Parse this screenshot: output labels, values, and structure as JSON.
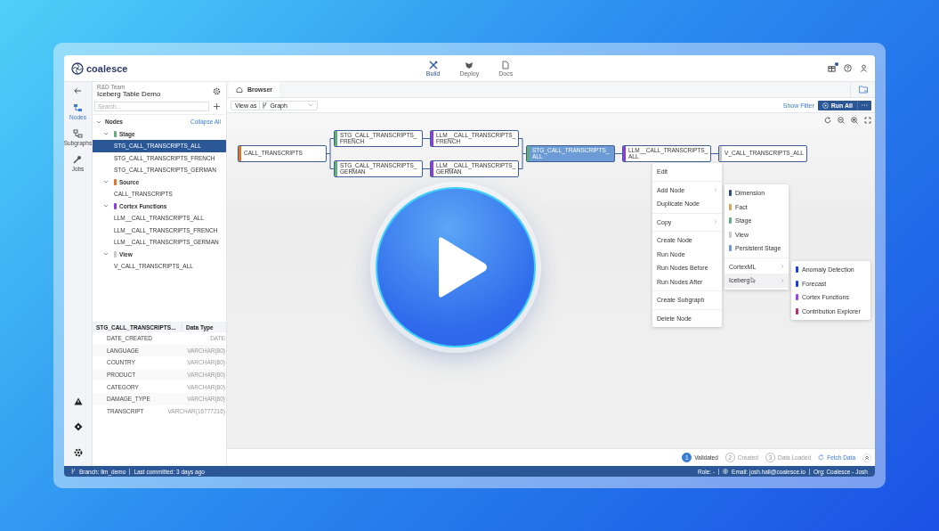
{
  "app": {
    "logo": "coalesce"
  },
  "nav_tabs": [
    {
      "label": "Build",
      "kind": "build",
      "selected": true
    },
    {
      "label": "Deploy",
      "kind": "deploy",
      "selected": false
    },
    {
      "label": "Docs",
      "kind": "docs",
      "selected": false
    }
  ],
  "header": {
    "gift_badge": true
  },
  "rail": [
    {
      "label": "Nodes",
      "kind": "nodes",
      "selected": true
    },
    {
      "label": "Subgraphs",
      "kind": "subgraphs",
      "selected": false
    },
    {
      "label": "Jobs",
      "kind": "jobs",
      "selected": false
    }
  ],
  "project": {
    "team": "R&D Team",
    "name": "Iceberg Table Demo"
  },
  "search": {
    "placeholder": "Search..."
  },
  "tree": {
    "label": "Nodes",
    "action": "Collapse All",
    "expanded": true,
    "children": [
      {
        "label": "Stage",
        "color": "#5fae7c",
        "expanded": true,
        "children": [
          {
            "label": "STG_CALL_TRANSCRIPTS_ALL",
            "selected": true
          },
          {
            "label": "STG_CALL_TRANSCRIPTS_FRENCH",
            "selected": false
          },
          {
            "label": "STG_CALL_TRANSCRIPTS_GERMAN",
            "selected": false
          }
        ]
      },
      {
        "label": "Source",
        "color": "#d9752c",
        "expanded": true,
        "children": [
          {
            "label": "CALL_TRANSCRIPTS",
            "selected": false
          }
        ]
      },
      {
        "label": "Cortex Functions",
        "color": "#8a3ee0",
        "expanded": true,
        "children": [
          {
            "label": "LLM__CALL_TRANSCRIPTS_ALL",
            "selected": false
          },
          {
            "label": "LLM__CALL_TRANSCRIPTS_FRENCH",
            "selected": false
          },
          {
            "label": "LLM__CALL_TRANSCRIPTS_GERMAN",
            "selected": false
          }
        ]
      },
      {
        "label": "View",
        "color": "#c8c8c8",
        "expanded": true,
        "children": [
          {
            "label": "V_CALL_TRANSCRIPTS_ALL",
            "selected": false
          }
        ]
      }
    ]
  },
  "columns_table": {
    "columns": [
      "STG_CALL_TRANSCRIPTS...",
      "Data Type"
    ],
    "rows": [
      {
        "name": "DATE_CREATED",
        "type": "DATE"
      },
      {
        "name": "LANGUAGE",
        "type": "VARCHAR(80)"
      },
      {
        "name": "COUNTRY",
        "type": "VARCHAR(80)"
      },
      {
        "name": "PRODUCT",
        "type": "VARCHAR(80)"
      },
      {
        "name": "CATEGORY",
        "type": "VARCHAR(80)"
      },
      {
        "name": "DAMAGE_TYPE",
        "type": "VARCHAR(80)"
      },
      {
        "name": "TRANSCRIPT",
        "type": "VARCHAR(16777216)"
      }
    ]
  },
  "browser_tab": {
    "label": "Browser"
  },
  "toolbar": {
    "view_as": "View as",
    "view": "Graph",
    "show_filter": "Show Filter",
    "run_all": "Run All"
  },
  "graph": {
    "nodes": [
      {
        "label": "CALL_TRANSCRIPTS",
        "color": "#d9752c",
        "selected": false
      },
      {
        "label": "STG_CALL_TRANSCRIPTS_FRENCH",
        "color": "#5fae7c",
        "selected": false
      },
      {
        "label": "STG_CALL_TRANSCRIPTS_GERMAN",
        "color": "#5fae7c",
        "selected": false
      },
      {
        "label": "LLM__CALL_TRANSCRIPTS_FRENCH",
        "color": "#8a3ee0",
        "selected": false
      },
      {
        "label": "LLM__CALL_TRANSCRIPTS_GERMAN",
        "color": "#8a3ee0",
        "selected": false
      },
      {
        "label": "STG_CALL_TRANSCRIPTS_ALL",
        "color": "#5fae7c",
        "selected": true
      },
      {
        "label": "LLM__CALL_TRANSCRIPTS_ALL",
        "color": "#8a3ee0",
        "selected": false
      },
      {
        "label": "V_CALL_TRANSCRIPTS_ALL",
        "color": "#c8c8c8",
        "selected": false
      }
    ]
  },
  "context_menu": [
    [
      {
        "label": "Edit",
        "submenu": false
      }
    ],
    [
      {
        "label": "Add Node",
        "submenu": true
      },
      {
        "label": "Duplicate Node",
        "submenu": false
      }
    ],
    [
      {
        "label": "Copy",
        "submenu": true
      }
    ],
    [
      {
        "label": "Create Node",
        "submenu": false
      },
      {
        "label": "Run Node",
        "submenu": false
      },
      {
        "label": "Run Nodes Before",
        "submenu": false
      },
      {
        "label": "Run Nodes After",
        "submenu": false
      }
    ],
    [
      {
        "label": "Create Subgraph",
        "submenu": false
      }
    ],
    [
      {
        "label": "Delete Node",
        "submenu": false
      }
    ]
  ],
  "node_type_menu": {
    "types": [
      {
        "label": "Dimension",
        "color": "#2c4a86"
      },
      {
        "label": "Fact",
        "color": "#d8a550"
      },
      {
        "label": "Stage",
        "color": "#5fae7c"
      },
      {
        "label": "View",
        "color": "#c8c8c8"
      },
      {
        "label": "Persistent Stage",
        "color": "#6b98d8"
      }
    ],
    "packages": [
      {
        "label": "CortexML",
        "selected": false
      },
      {
        "label": "Iceberg",
        "selected": true
      }
    ]
  },
  "package_menu": [
    {
      "label": "Anomaly Detection",
      "color": "#1a3de0"
    },
    {
      "label": "Forecast",
      "color": "#1a3de0"
    },
    {
      "label": "Cortex Functions",
      "color": "#9a45e8"
    },
    {
      "label": "Contribution Explorer",
      "color": "#b0307a"
    }
  ],
  "steps": [
    {
      "number": "1",
      "label": "Validated",
      "done": true
    },
    {
      "number": "2",
      "label": "Created",
      "done": false
    },
    {
      "number": "3",
      "label": "Data Loaded",
      "done": false
    }
  ],
  "fetch_data": "Fetch Data",
  "status_bar": {
    "branch": "Branch: llm_demo",
    "commit": "Last committed: 3 days ago",
    "role": "Role: -",
    "email": "Email: josh.hall@coalesce.io",
    "org": "Org: Coalesce - Josh"
  }
}
